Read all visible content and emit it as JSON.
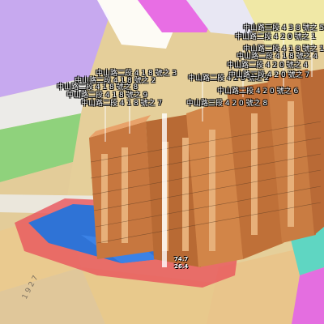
{
  "map": {
    "colors": {
      "background": "#d9d0c0",
      "road": "#e9e6e1",
      "residential_zone": "#e8c98c",
      "commercial_zone": "#f28fa0",
      "public_zone": "#b59be3",
      "magenta_zone": "#e46ee0",
      "green_zone": "#8fd27c",
      "teal_zone": "#5fd6c2",
      "site_boundary": "#e8545b",
      "podium": "#2f73d6",
      "building_facade": "#d9894a",
      "building_shadow": "#7a5a3a"
    },
    "address_labels": [
      "中山路三段 4 3 8 號之 5",
      "中山路二段 4 2 0 號之 1",
      "中山路二段 4 1 8 號之 1",
      "中山路二段 4 1 8 號之 4",
      "中山路二段 4 1 8 號之 3",
      "中山路二段 4 2 0 號之 4",
      "中山路二段 4 1 8 號之 2",
      "中山路二段 4 2 0 號之 2",
      "中山路二段 4 1 8 號之 8",
      "中山路二段 4 2 0 號之 7",
      "中山路二段 4 1 8 號之 9",
      "中山路二段 4 2 0 號之 6",
      "中山路二段 4 1 8 號之 7",
      "中山路三段 4 2 0 號之 8"
    ],
    "building_heights": [
      "74.7",
      "26.4"
    ],
    "parcel_number": "1 9 2 7"
  }
}
